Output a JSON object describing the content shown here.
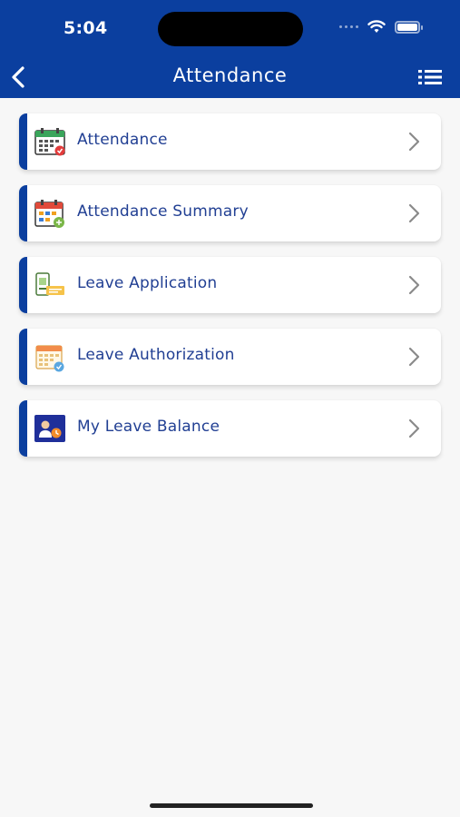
{
  "status": {
    "time": "5:04"
  },
  "header": {
    "title": "Attendance",
    "background": "#0b3f9f"
  },
  "menu": {
    "items": [
      {
        "label": "Attendance",
        "icon": "attendance-calendar-icon"
      },
      {
        "label": "Attendance Summary",
        "icon": "attendance-summary-icon"
      },
      {
        "label": "Leave Application",
        "icon": "leave-application-icon"
      },
      {
        "label": "Leave Authorization",
        "icon": "leave-authorization-icon"
      },
      {
        "label": "My Leave Balance",
        "icon": "leave-balance-icon"
      }
    ]
  },
  "colors": {
    "accent": "#0b3f9f",
    "label": "#213f93",
    "background": "#f7f7f7"
  }
}
